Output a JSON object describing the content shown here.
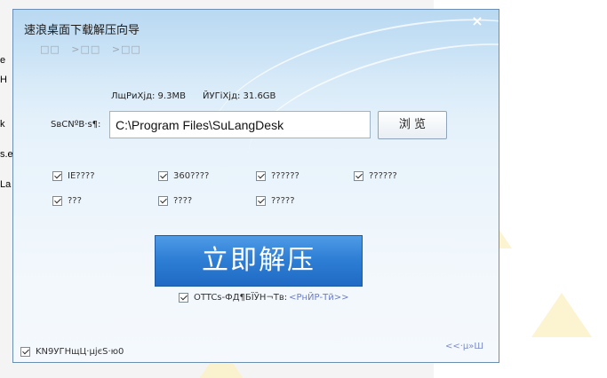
{
  "background": {
    "strip_fragments": [
      "e",
      "H",
      "k",
      "s.e",
      "La"
    ]
  },
  "dialog": {
    "title": "速浪桌面下载解压向导",
    "close_glyph": "×",
    "steps": [
      "□□",
      ">□□",
      ">□□"
    ],
    "size_info": "ЛщРиХјд: 9.3MB",
    "free_info": "ЙУГіХјд: 31.6GB",
    "path_label": "SвCNºB·s¶:",
    "path_value": "C:\\Program Files\\SuLangDesk",
    "browse_label": "浏 览",
    "checkboxes_row1": [
      "IE????",
      "360????",
      "??????",
      "??????"
    ],
    "checkboxes_row2": [
      "???",
      "????",
      "?????"
    ],
    "extract_button": "立即解压",
    "agree_text": "OTTCs-ФД¶БЇЎН¬Тв:",
    "agree_link": "<РнЙР-Тй>>",
    "bottom_checkbox": "KN9УГНщЦ·µјєS·ю0",
    "back_link": "<<·µ»Ш"
  },
  "colors": {
    "primary_button": "#2f7fd6",
    "link": "#6a7cc8"
  }
}
